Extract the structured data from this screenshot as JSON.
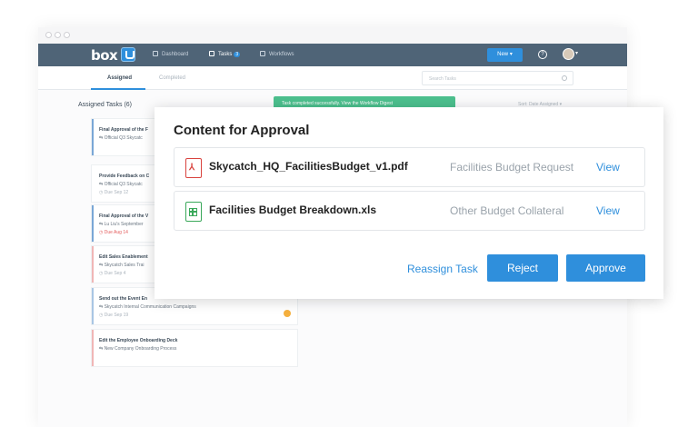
{
  "navbar": {
    "logo": "box",
    "items": [
      {
        "label": "Dashboard"
      },
      {
        "label": "Tasks",
        "badge": "3"
      },
      {
        "label": "Workflows"
      }
    ],
    "new_button": "New",
    "help_glyph": "?"
  },
  "tabs": [
    {
      "label": "Assigned"
    },
    {
      "label": "Completed"
    }
  ],
  "search": {
    "placeholder": "Search Tasks"
  },
  "list": {
    "title": "Assigned Tasks (6)",
    "sort_label": "Sort: Date Assigned",
    "toast": "Task completed successfully.   View the Workflow Digest"
  },
  "tasks": [
    {
      "title": "Final Approval of the F",
      "subtitle": "Official Q3 Skycatc",
      "due": ""
    },
    {
      "title": "Provide Feedback on C",
      "subtitle": "Official Q3 Skycatc",
      "due": "Due Sep 12"
    },
    {
      "title": "Final Approval of the V",
      "subtitle": "Lu Liu's September",
      "due": "Due Aug 14"
    },
    {
      "title": "Edit Sales Enablement",
      "subtitle": "Skycatch Sales Trai",
      "due": "Due Sep 4"
    },
    {
      "title": "Send out the Event En",
      "subtitle": "Skycatch Internal Communication Campaigns",
      "due": "Due Sep 19"
    },
    {
      "title": "Edit the Employee Onboarding Deck",
      "subtitle": "New Company Onboarding Process",
      "due": ""
    }
  ],
  "modal": {
    "title": "Content for Approval",
    "files": [
      {
        "name": "Skycatch_HQ_FacilitiesBudget_v1.pdf",
        "category": "Facilities Budget Request",
        "action": "View",
        "icon": "pdf-file-icon"
      },
      {
        "name": "Facilities Budget Breakdown.xls",
        "category": "Other Budget Collateral",
        "action": "View",
        "icon": "spreadsheet-file-icon"
      }
    ],
    "reassign_label": "Reassign Task",
    "reject_label": "Reject",
    "approve_label": "Approve"
  },
  "colors": {
    "accent": "#2f8fdc",
    "navbar": "#4f6477",
    "success": "#4cc08e",
    "overdue": "#e35d5d"
  }
}
